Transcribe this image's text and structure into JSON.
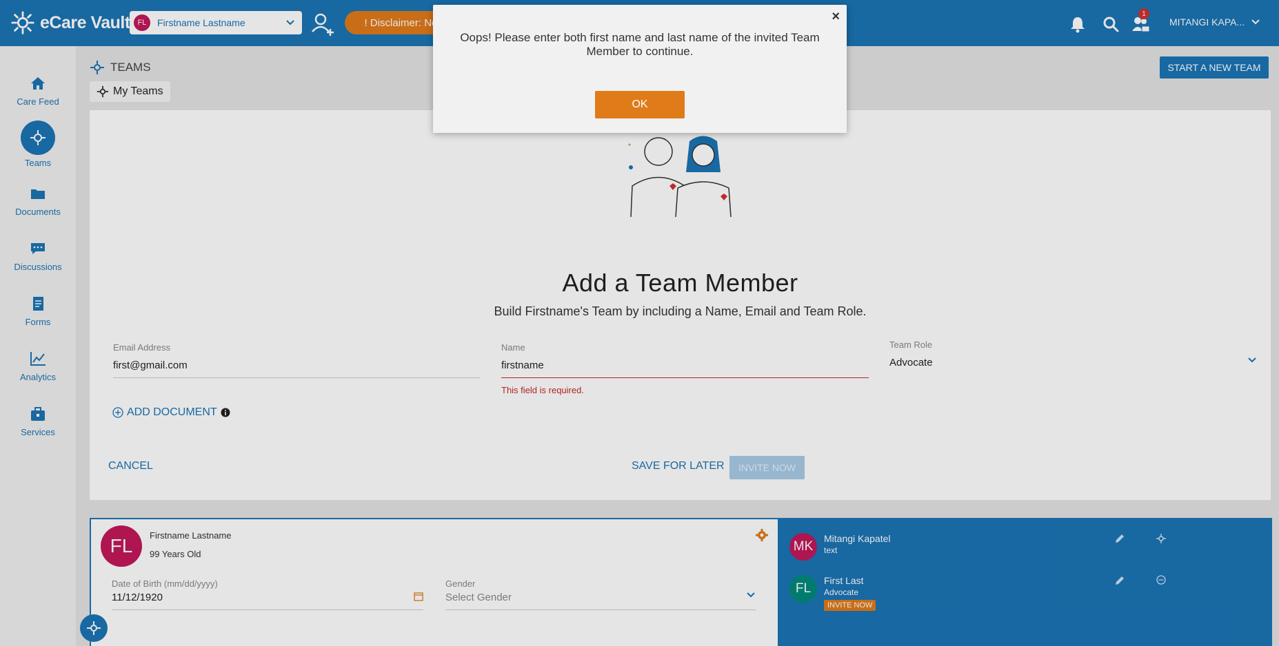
{
  "app": {
    "name": "eCare Vault"
  },
  "header": {
    "patient_initials": "FL",
    "patient_name": "Firstname Lastname",
    "disclaimer": "! Disclaimer: Not Production",
    "notification_count": "1",
    "user_name": "MITANGI KAPA..."
  },
  "sidebar": {
    "items": [
      {
        "label": "Care Feed",
        "icon": "home-icon"
      },
      {
        "label": "Teams",
        "icon": "teams-icon"
      },
      {
        "label": "Documents",
        "icon": "folder-icon"
      },
      {
        "label": "Discussions",
        "icon": "chat-icon"
      },
      {
        "label": "Forms",
        "icon": "form-icon"
      },
      {
        "label": "Analytics",
        "icon": "chart-icon"
      },
      {
        "label": "Services",
        "icon": "briefcase-icon"
      }
    ]
  },
  "page": {
    "section_title": "TEAMS",
    "my_teams": "My Teams",
    "start_new_team": "START A NEW TEAM"
  },
  "form": {
    "title": "Add a Team Member",
    "subtitle": "Build Firstname's Team by including a Name, Email and Team Role.",
    "email_label": "Email Address",
    "email_value": "first@gmail.com",
    "name_label": "Name",
    "name_value": "firstname",
    "name_error": "This field is required.",
    "role_label": "Team Role",
    "role_value": "Advocate",
    "add_document": "ADD DOCUMENT",
    "cancel": "CANCEL",
    "save_later": "SAVE FOR LATER",
    "invite_now": "INVITE NOW"
  },
  "patient_card": {
    "initials": "FL",
    "name": "Firstname Lastname",
    "age": "99 Years Old",
    "dob_label": "Date of Birth (mm/dd/yyyy)",
    "dob_value": "11/12/1920",
    "gender_label": "Gender",
    "gender_placeholder": "Select Gender"
  },
  "team_members": [
    {
      "initials": "MK",
      "name": "Mitangi Kapatel",
      "role": "text",
      "color": "#c2185b"
    },
    {
      "initials": "FL",
      "name": "First Last",
      "role": "Advocate",
      "invite": "INVITE NOW",
      "color": "#00897b"
    }
  ],
  "dialog": {
    "message": "Oops! Please enter both first name and last name of the invited Team Member to continue.",
    "ok": "OK",
    "close": "×"
  },
  "colors": {
    "primary": "#1b74b5",
    "accent": "#e07b1a",
    "error": "#c62828"
  }
}
